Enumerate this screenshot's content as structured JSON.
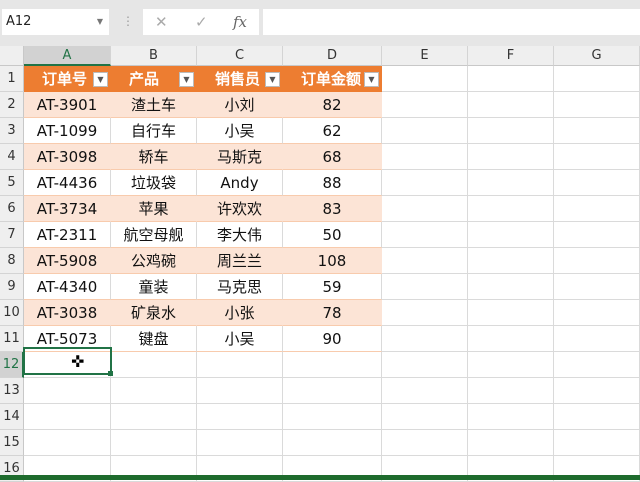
{
  "name_box": "A12",
  "formula_bar": {
    "cancel_icon": "✕",
    "enter_icon": "✓",
    "fx_label": "fx",
    "value": ""
  },
  "columns": [
    "A",
    "B",
    "C",
    "D",
    "E",
    "F",
    "G"
  ],
  "rows": [
    "1",
    "2",
    "3",
    "4",
    "5",
    "6",
    "7",
    "8",
    "9",
    "10",
    "11",
    "12",
    "13",
    "14",
    "15",
    "16"
  ],
  "table": {
    "headers": [
      "订单号",
      "产品",
      "销售员",
      "订单金额"
    ],
    "data": [
      [
        "AT-3901",
        "渣土车",
        "小刘",
        "82"
      ],
      [
        "AT-1099",
        "自行车",
        "小吴",
        "62"
      ],
      [
        "AT-3098",
        "轿车",
        "马斯克",
        "68"
      ],
      [
        "AT-4436",
        "垃圾袋",
        "Andy",
        "88"
      ],
      [
        "AT-3734",
        "苹果",
        "许欢欢",
        "83"
      ],
      [
        "AT-2311",
        "航空母舰",
        "李大伟",
        "50"
      ],
      [
        "AT-5908",
        "公鸡碗",
        "周兰兰",
        "108"
      ],
      [
        "AT-4340",
        "童装",
        "马克思",
        "59"
      ],
      [
        "AT-3038",
        "矿泉水",
        "小张",
        "78"
      ],
      [
        "AT-5073",
        "键盘",
        "小吴",
        "90"
      ]
    ]
  },
  "colors": {
    "header": "#ed7d31",
    "band": "#fce4d6",
    "accent": "#217346"
  }
}
